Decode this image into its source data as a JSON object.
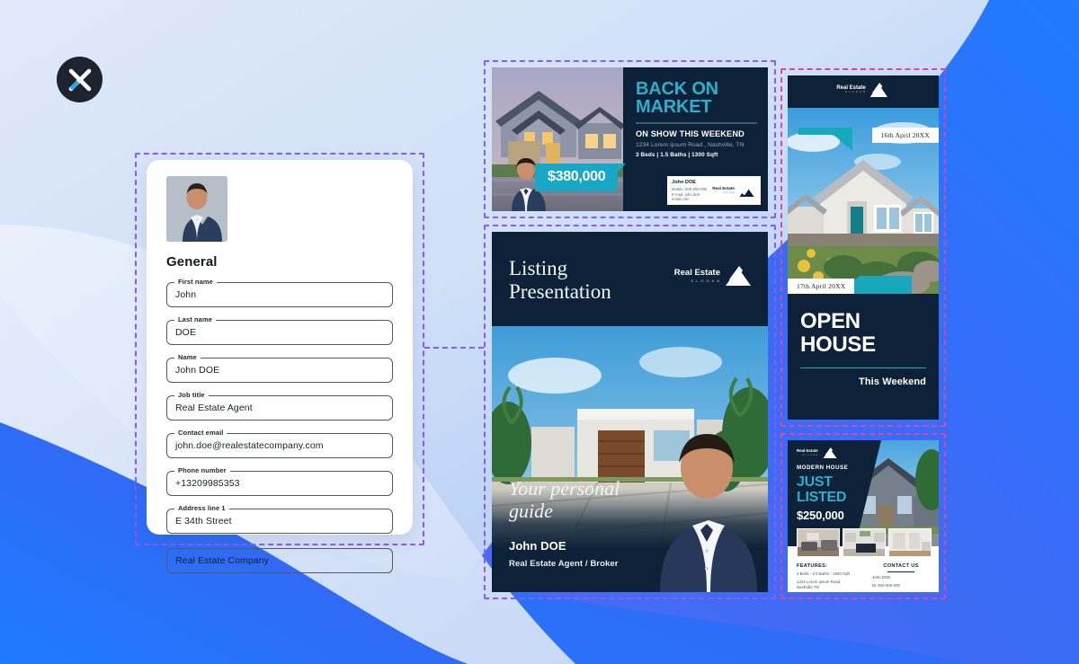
{
  "brand": {
    "logo_icon": "x-mark-logo"
  },
  "form": {
    "avatar_alt": "agent-headshot",
    "section_title": "General",
    "fields": [
      {
        "label": "First name",
        "value": "John",
        "name": "first-name"
      },
      {
        "label": "Last name",
        "value": "DOE",
        "name": "last-name"
      },
      {
        "label": "Name",
        "value": "John DOE",
        "name": "full-name"
      },
      {
        "label": "Job title",
        "value": "Real Estate Agent",
        "name": "job-title"
      },
      {
        "label": "Contact email",
        "value": "john.doe@realestatecompany.com",
        "name": "contact-email"
      },
      {
        "label": "Phone number",
        "value": "+13209985353",
        "name": "phone-number"
      },
      {
        "label": "Address line 1",
        "value": "E 34th Street",
        "name": "address-line-1"
      }
    ],
    "company_field": {
      "label": "",
      "value": "Real Estate Company",
      "name": "company-name"
    }
  },
  "cards": {
    "back_on_market": {
      "headline_l1": "BACK ON",
      "headline_l2": "MARKET",
      "subhead": "ON SHOW THIS WEEKEND",
      "address": "1234 Lorem ipsum Road , Nashville, TN",
      "specs": "3 Beds | 1.5 Baths | 1300 Sqft",
      "price": "$380,000",
      "contact_name": "John DOE",
      "contact_mobile": "Mobile:  000-000-000",
      "contact_email": "E-mail:  john.doe-email.com",
      "logo_name": "Real Estate",
      "logo_slogan": "S L O G A N"
    },
    "listing_presentation": {
      "title_l1": "Listing",
      "title_l2": "Presentation",
      "logo_name": "Real Estate",
      "logo_slogan": "S L O G A N",
      "script_l1": "Your personal",
      "script_l2": "guide",
      "agent_name": "John DOE",
      "agent_role": "Real Estate Agent / Broker"
    },
    "open_house": {
      "logo_name": "Real Estate",
      "logo_slogan": "S L O G A N",
      "date_top": "16th April 20XX",
      "date_bottom": "17th April 20XX",
      "headline_l1": "OPEN",
      "headline_l2": "HOUSE",
      "subhead": "This Weekend"
    },
    "just_listed": {
      "logo_name": "Real Estate",
      "logo_slogan": "S L O G A N",
      "kicker": "MODERN HOUSE",
      "headline_l1": "JUST",
      "headline_l2": "LISTED",
      "price": "$250,000",
      "features_title": "FEATURES:",
      "features_l1": "3 Beds - 2.5 Baths - 1900 Sqft",
      "features_l2": "1234 Lorem ipsum Road, Nashville TN",
      "contact_title": "CONTACT US",
      "contact_l1": "John DOE",
      "contact_l2": "M: 000-000-000"
    }
  },
  "colors": {
    "navy": "#0d2238",
    "teal": "#29b0cc",
    "accent_blue": "#2f6bf6",
    "dash_purple": "#8b5cf6",
    "dash_pink": "#d946a8"
  }
}
